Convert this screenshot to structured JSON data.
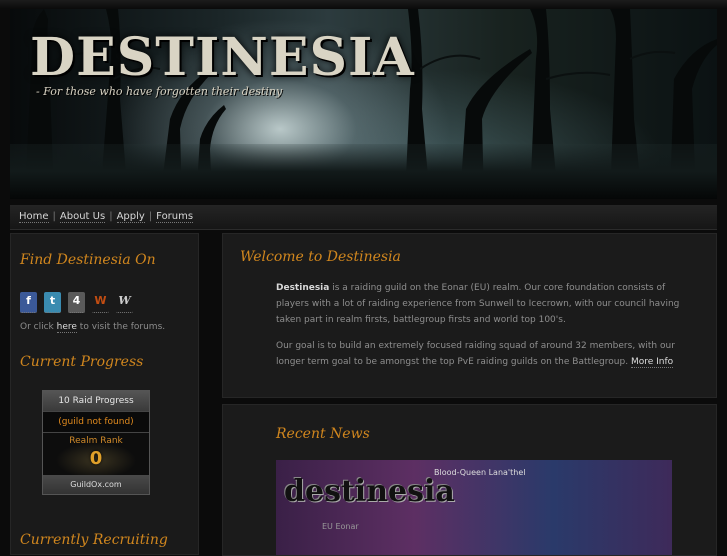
{
  "banner": {
    "logo_title": "DESTINESIA",
    "tagline": "- For those who have forgotten their destiny"
  },
  "nav": {
    "items": [
      "Home",
      "About Us",
      "Apply",
      "Forums"
    ],
    "separator": "|"
  },
  "sidebar": {
    "find_heading": "Find Destinesia On",
    "icons": [
      {
        "name": "facebook-icon",
        "glyph": "f",
        "color": "#3b5998"
      },
      {
        "name": "twitter-icon",
        "glyph": "t",
        "color": "#3a8bb0"
      },
      {
        "name": "forum-icon",
        "glyph": "4",
        "color": "#5a5a5a"
      },
      {
        "name": "wowhead-icon",
        "glyph": "W",
        "color": "#c24d12"
      },
      {
        "name": "wowwiki-icon",
        "glyph": "W",
        "color": "#cccccc"
      }
    ],
    "forums_text_before": "Or click",
    "forums_link": "here",
    "forums_text_after": "to visit the forums.",
    "progress_heading": "Current Progress",
    "progress_widget": {
      "header": "10 Raid Progress",
      "status": "(guild not found)",
      "realm_rank_label": "Realm Rank",
      "realm_rank_value": "0",
      "footer": "GuildOx.com"
    },
    "recruiting_heading": "Currently Recruiting"
  },
  "welcome": {
    "heading": "Welcome to Destinesia",
    "guild_name": "Destinesia",
    "para1_rest": "is a raiding guild on the Eonar (EU) realm. Our core foundation consists of players with a lot of raiding experience from Sunwell to Icecrown, with our council having taken part in realm firsts, battlegroup firsts and world top 100's.",
    "para2": "Our goal is to build an extremely focused raiding squad of around 32 members, with our longer term goal to be amongst the top PvE raiding guilds on the Battlegroup.",
    "more_info": "More Info"
  },
  "news": {
    "heading": "Recent News",
    "image_word": "destinesia",
    "image_caption": "Blood-Queen Lana'thel",
    "image_subtext": "EU Eonar"
  },
  "colors": {
    "accent": "#d0861e",
    "background": "#0b0b0b",
    "panel": "#1b1b1b"
  }
}
